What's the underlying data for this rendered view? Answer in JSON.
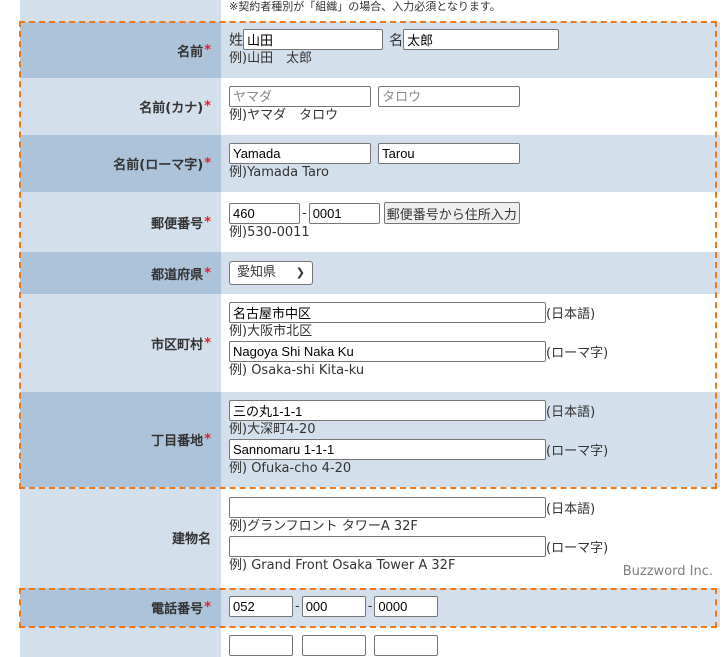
{
  "top_note": "※契約者種別が「組織」の場合、入力必須となります。",
  "required_mark": "*",
  "name": {
    "label": "名前",
    "last_prefix": "姓",
    "last_value": "山田",
    "first_prefix": "名",
    "first_value": "太郎",
    "example": "例)山田　太郎"
  },
  "name_kana": {
    "label": "名前(カナ)",
    "last_placeholder": "ヤマダ",
    "first_placeholder": "タロウ",
    "example": "例)ヤマダ　タロウ"
  },
  "name_roman": {
    "label": "名前(ローマ字)",
    "last_value": "Yamada",
    "first_value": "Tarou",
    "example": "例)Yamada Taro"
  },
  "postal": {
    "label": "郵便番号",
    "part1": "460",
    "separator": "-",
    "part2": "0001",
    "lookup_button": "郵便番号から住所入力",
    "example": "例)530-0011"
  },
  "prefecture": {
    "label": "都道府県",
    "selected": "愛知県"
  },
  "city": {
    "label": "市区町村",
    "ja_value": "名古屋市中区",
    "ja_suffix": "(日本語)",
    "ja_example": "例)大阪市北区",
    "roman_value": "Nagoya Shi Naka Ku",
    "roman_suffix": "(ローマ字)",
    "roman_example": "例) Osaka-shi Kita-ku"
  },
  "street": {
    "label": "丁目番地",
    "ja_value": "三の丸1-1-1",
    "ja_suffix": "(日本語)",
    "ja_example": "例)大深町4-20",
    "roman_value": "Sannomaru 1-1-1",
    "roman_suffix": "(ローマ字)",
    "roman_example": "例) Ofuka-cho 4-20"
  },
  "building": {
    "label": "建物名",
    "ja_value": "",
    "ja_suffix": "(日本語)",
    "ja_example": "例)グランフロント タワーA 32F",
    "roman_value": "",
    "roman_suffix": "(ローマ字)",
    "roman_example": "例) Grand Front Osaka Tower A 32F"
  },
  "phone": {
    "label": "電話番号",
    "part1": "052",
    "separator": "-",
    "part2": "000",
    "part3": "0000"
  },
  "watermark": "Buzzword Inc.",
  "colors": {
    "highlight": "#f07818",
    "required": "#e8202a",
    "label_dark": "#adc3da",
    "label_light": "#d3dfea"
  }
}
